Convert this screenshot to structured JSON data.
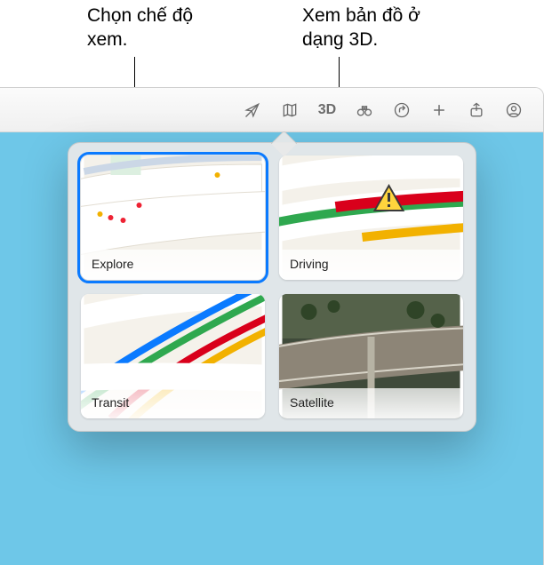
{
  "callouts": {
    "left": "Chọn chế độ xem.",
    "right": "Xem bản đồ ở dạng 3D."
  },
  "toolbar": {
    "navigate_icon": "location-arrow",
    "map_mode_icon": "map",
    "view3d_label": "3D",
    "lookaround_icon": "binoculars",
    "directions_icon": "turn-arrow",
    "add_icon": "plus",
    "share_icon": "share",
    "account_icon": "account"
  },
  "map_modes": {
    "options": [
      {
        "label": "Explore",
        "selected": true,
        "kind": "explore"
      },
      {
        "label": "Driving",
        "selected": false,
        "kind": "driving"
      },
      {
        "label": "Transit",
        "selected": false,
        "kind": "transit"
      },
      {
        "label": "Satellite",
        "selected": false,
        "kind": "satellite"
      }
    ]
  },
  "colors": {
    "accent": "#0a7aff",
    "water": "#6ec7e8"
  }
}
